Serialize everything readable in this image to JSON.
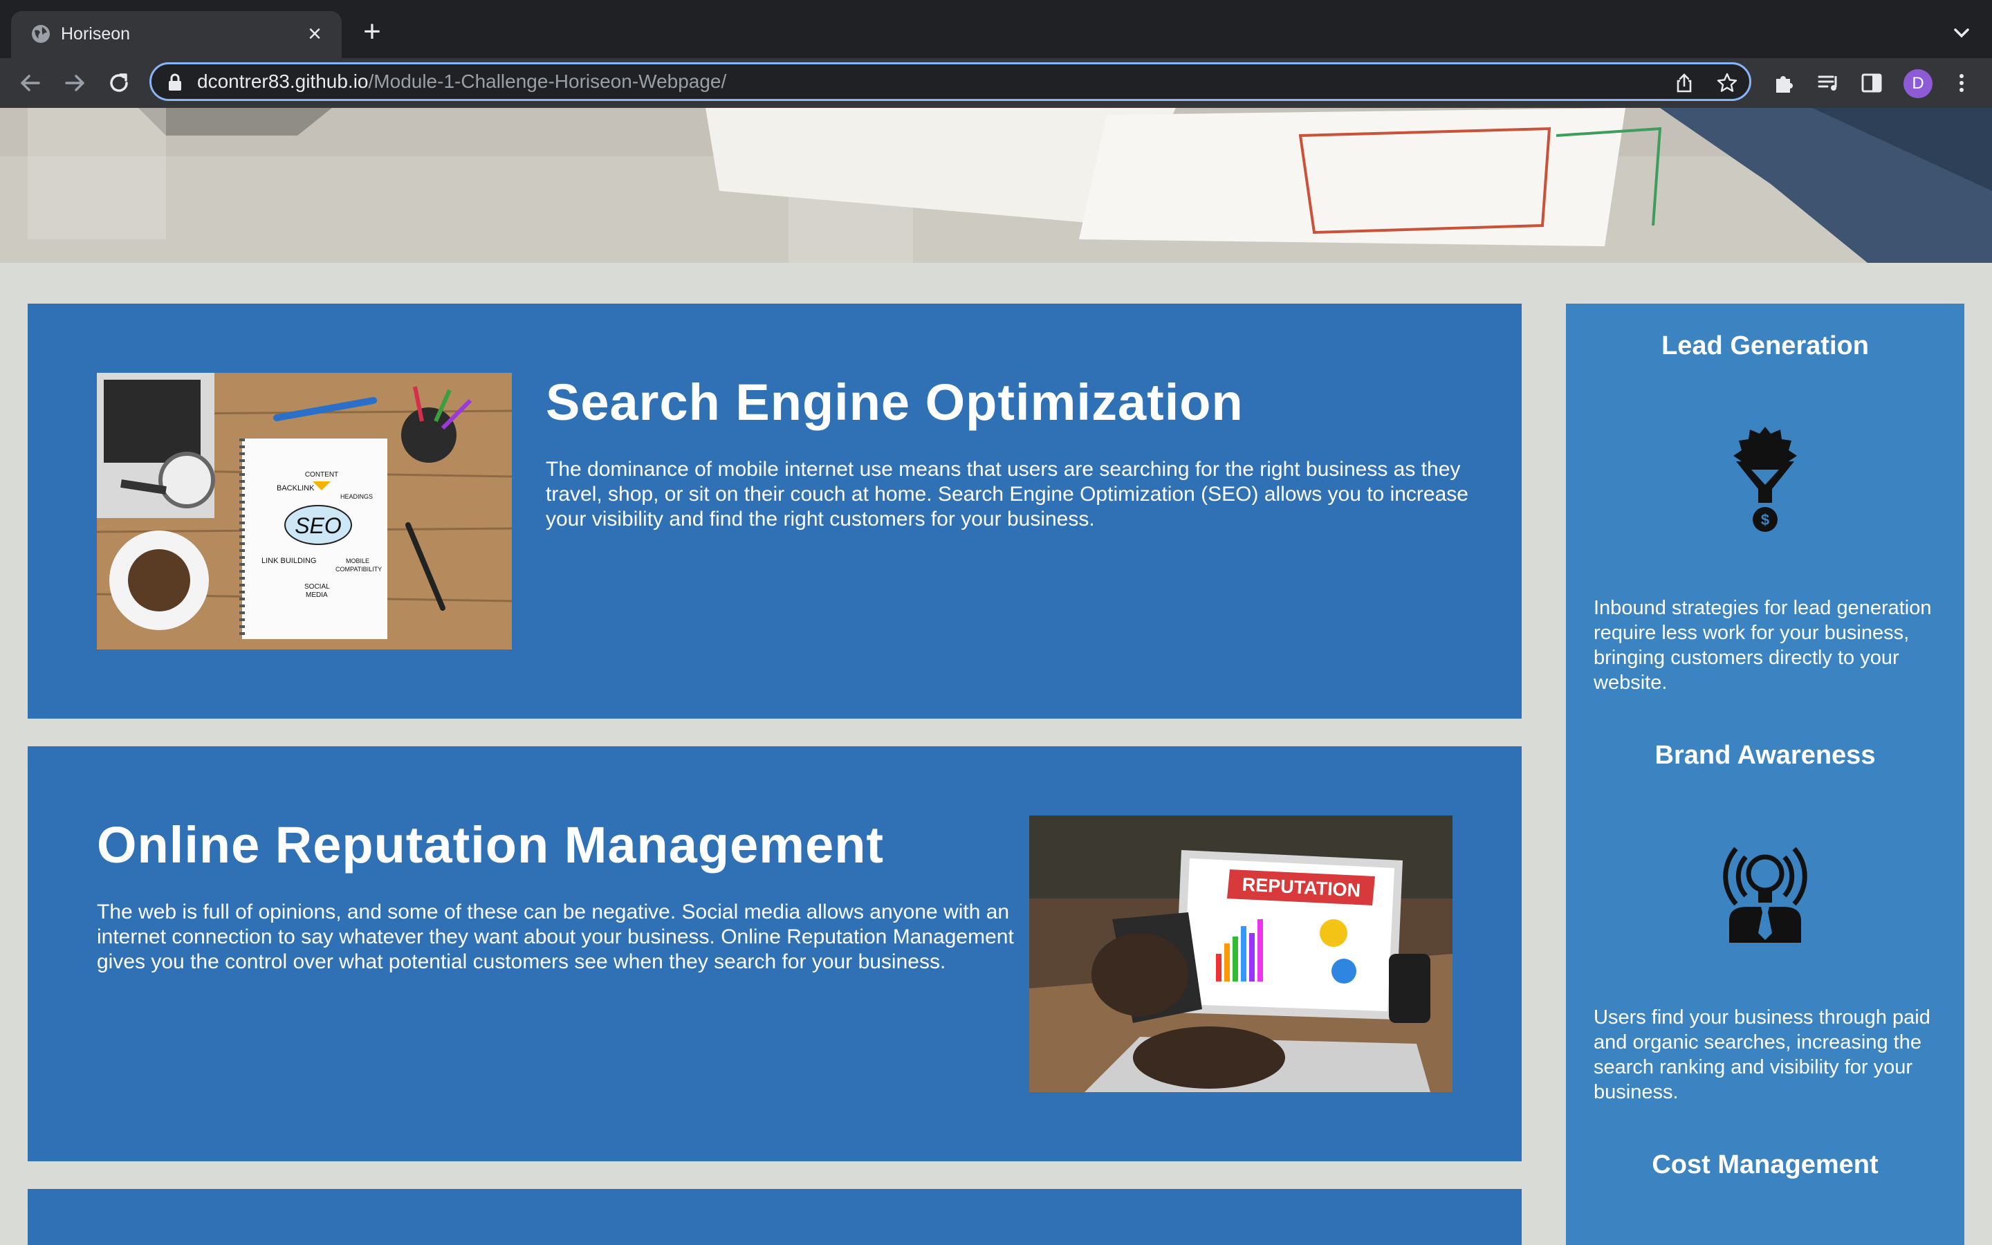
{
  "browser": {
    "tab_title": "Horiseon",
    "url_host": "dcontrer83.github.io",
    "url_path": "/Module-1-Challenge-Horiseon-Webpage/",
    "profile_initial": "D"
  },
  "main": {
    "sections": [
      {
        "title": "Search Engine Optimization",
        "text": "The dominance of mobile internet use means that users are searching for the right business as they travel, shop, or sit on their couch at home. Search Engine Optimization (SEO) allows you to increase your visibility and find the right customers for your business.",
        "image_words": {
          "seo": "SEO",
          "content": "CONTENT",
          "backlink": "BACKLINK",
          "headings": "HEADINGS",
          "link_building": "LINK BUILDING",
          "mobile": "MOBILE",
          "compatibility": "COMPATIBILITY",
          "social": "SOCIAL",
          "media": "MEDIA"
        }
      },
      {
        "title": "Online Reputation Management",
        "text": "The web is full of opinions, and some of these can be negative. Social media allows anyone with an internet connection to say whatever they want about your business. Online Reputation Management gives you the control over what potential customers see when they search for your business.",
        "image_words": {
          "banner": "REPUTATION"
        }
      }
    ]
  },
  "benefits": [
    {
      "title": "Lead Generation",
      "icon": "lead-generation-icon",
      "text": "Inbound strategies for lead generation require less work for your business, bringing customers directly to your website."
    },
    {
      "title": "Brand Awareness",
      "icon": "brand-awareness-icon",
      "text": "Users find your business through paid and organic searches, increasing the search ranking and visibility for your business."
    },
    {
      "title": "Cost Management",
      "icon": "cost-management-icon",
      "text": ""
    }
  ],
  "colors": {
    "page_background": "#d9dcd6",
    "content_blue": "#3071b5",
    "benefits_blue": "#3b84c1",
    "text": "#ffffff"
  }
}
